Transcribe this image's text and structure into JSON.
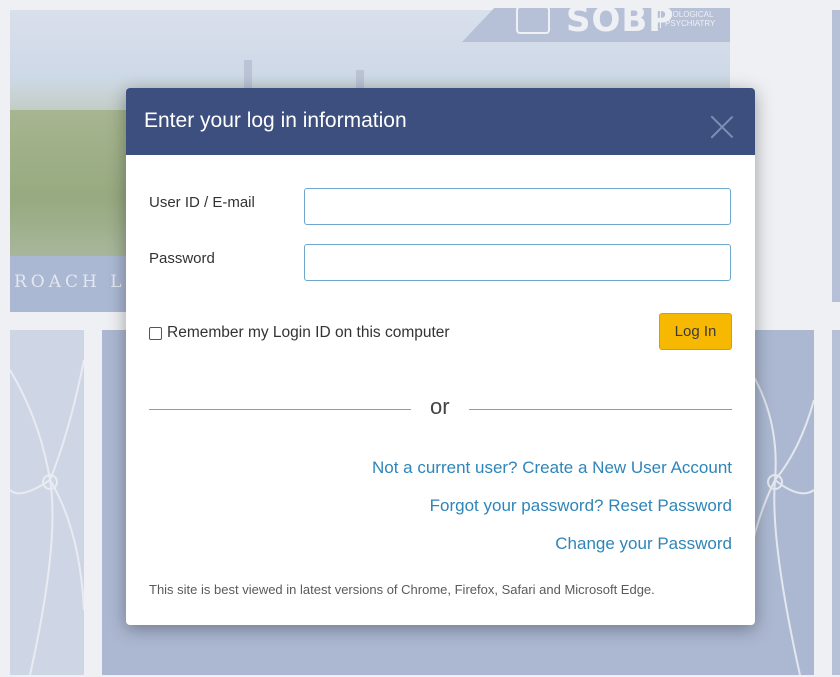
{
  "background": {
    "hero_text": "ROACH L",
    "logo": {
      "text": "SOBP",
      "sub_line1": "BIOLOGICAL",
      "sub_line2": "PSYCHIATRY"
    }
  },
  "modal": {
    "title": "Enter your log in information",
    "fields": {
      "user_label": "User ID / E-mail",
      "user_value": "",
      "password_label": "Password",
      "password_value": ""
    },
    "remember_label": "Remember my Login ID on this computer",
    "remember_checked": false,
    "login_button": "Log In",
    "divider_text": "or",
    "links": {
      "create_account": "Not a current user? Create a New User Account",
      "reset_password": "Forgot your password? Reset Password",
      "change_password": "Change your Password"
    },
    "footnote": "This site is best viewed in latest versions of Chrome, Firefox, Safari and Microsoft Edge."
  },
  "colors": {
    "header_bg": "#3d4f7e",
    "accent_button": "#f6b800",
    "link": "#2f85b8",
    "input_border": "#6fa6cc"
  }
}
